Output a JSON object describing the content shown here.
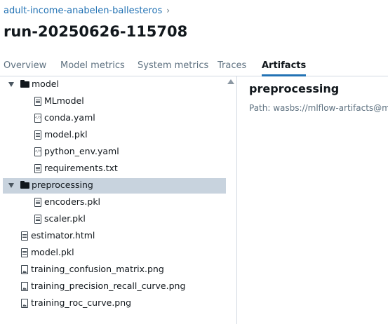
{
  "breadcrumb": {
    "experiment": "adult-income-anabelen-ballesteros",
    "separator": "›"
  },
  "page_title": "run-20250626-115708",
  "tabs": [
    {
      "label": "Overview"
    },
    {
      "label": "Model metrics"
    },
    {
      "label": "System metrics"
    },
    {
      "label": "Traces"
    },
    {
      "label": "Artifacts",
      "active": true
    }
  ],
  "tree": {
    "items": [
      {
        "label": "model",
        "type": "folder",
        "expanded": true
      },
      {
        "label": "MLmodel",
        "type": "file",
        "icon": "document-icon"
      },
      {
        "label": "conda.yaml",
        "type": "file",
        "icon": "code-file-icon"
      },
      {
        "label": "model.pkl",
        "type": "file",
        "icon": "document-icon"
      },
      {
        "label": "python_env.yaml",
        "type": "file",
        "icon": "code-file-icon"
      },
      {
        "label": "requirements.txt",
        "type": "file",
        "icon": "document-icon"
      },
      {
        "label": "preprocessing",
        "type": "folder",
        "expanded": true,
        "selected": true
      },
      {
        "label": "encoders.pkl",
        "type": "file",
        "icon": "document-icon"
      },
      {
        "label": "scaler.pkl",
        "type": "file",
        "icon": "document-icon"
      },
      {
        "label": "estimator.html",
        "type": "file",
        "icon": "document-icon"
      },
      {
        "label": "model.pkl",
        "type": "file",
        "icon": "document-icon"
      },
      {
        "label": "training_confusion_matrix.png",
        "type": "file",
        "icon": "image-file-icon"
      },
      {
        "label": "training_precision_recall_curve.png",
        "type": "file",
        "icon": "image-file-icon"
      },
      {
        "label": "training_roc_curve.png",
        "type": "file",
        "icon": "image-file-icon"
      }
    ]
  },
  "detail": {
    "title": "preprocessing",
    "path": "Path: wasbs://mlflow-artifacts@m"
  },
  "colors": {
    "accent": "#2272b4",
    "selected_row": "#c8d3de",
    "border": "#d1d9e1"
  }
}
